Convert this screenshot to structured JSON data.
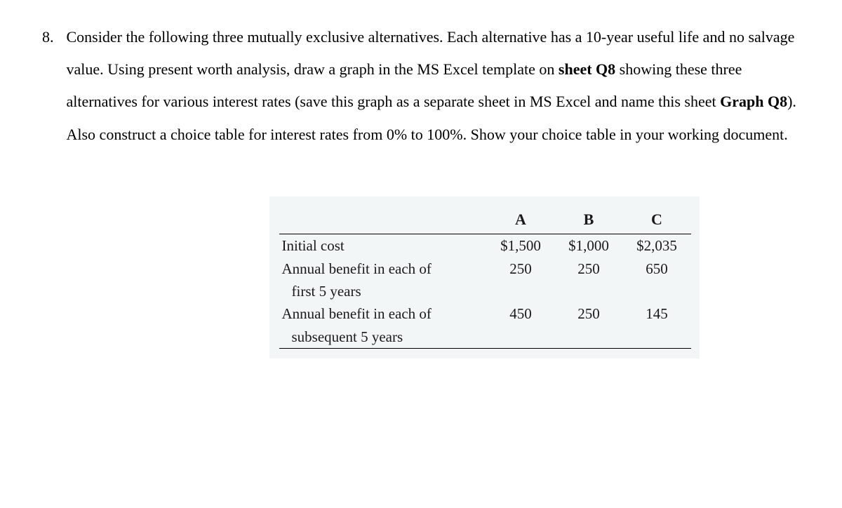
{
  "question": {
    "number": "8.",
    "text_parts": {
      "p1": "Consider the following three mutually exclusive alternatives. Each alternative has a 10-year useful life and no salvage value. Using present worth analysis, draw a graph in the MS Excel template on ",
      "b1": "sheet Q8",
      "p2": " showing these three alternatives for various interest rates (save this graph as a separate sheet in MS Excel and name this sheet ",
      "b2": "Graph Q8",
      "p3": "). Also construct a choice table for interest rates from 0% to 100%. Show your choice table in your working document."
    }
  },
  "table": {
    "headers": {
      "a": "A",
      "b": "B",
      "c": "C"
    },
    "rows": [
      {
        "label_main": "Initial cost",
        "label_sub": "",
        "a": "$1,500",
        "b": "$1,000",
        "c": "$2,035"
      },
      {
        "label_main": "Annual benefit in each of",
        "label_sub": "first 5 years",
        "a": "250",
        "b": "250",
        "c": "650"
      },
      {
        "label_main": "Annual benefit in each of",
        "label_sub": "subsequent 5 years",
        "a": "450",
        "b": "250",
        "c": "145"
      }
    ]
  }
}
